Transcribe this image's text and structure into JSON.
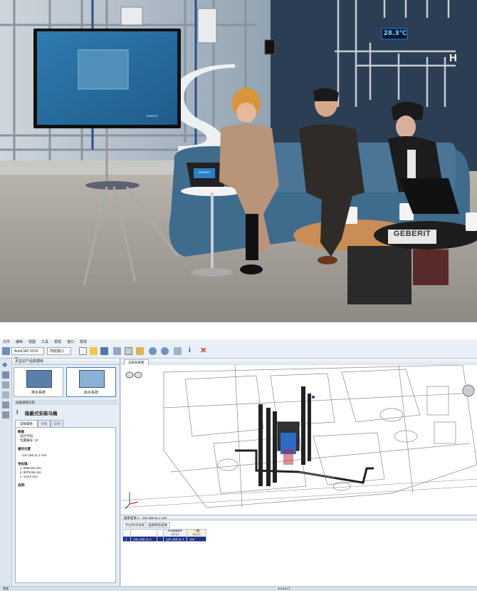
{
  "photo": {
    "temperature_display": "28.3℃",
    "wall_letter": "H",
    "brand_sign": "GEBERIT",
    "laptop_brand": "GEBERIT",
    "monitor_brand": "GEBERIT"
  },
  "app": {
    "menu": [
      "文件",
      "编辑",
      "视图",
      "工具",
      "帮助",
      "窗口",
      "帮助"
    ],
    "toolbar": {
      "dropdown1": "AutoCAD 2016 20",
      "dropdown2": "导航窗口"
    },
    "panel": {
      "title": "天宝达产品数据库",
      "tiles": [
        {
          "label": "排水系统"
        },
        {
          "label": "给水系统"
        }
      ],
      "section_title": "设备属性信息",
      "selected_item": "隐蔽式安装马桶",
      "tabs": [
        "常规属性",
        "参数",
        "说明"
      ],
      "props": {
        "data_header": "数据",
        "data_line1": "设计代码:",
        "data_line2": "位置编号: 10",
        "position_header": "编号位置",
        "position_value": "- 131.165.11.1 mm",
        "coords_header": "坐标值:",
        "x": "x: 5903.83 mm",
        "y": "y: 9879.56 mm",
        "z": "z: 144.8 mm",
        "notes_header": "说明:"
      }
    },
    "viewport": {
      "tab_label": "渲染效果图"
    },
    "results": {
      "title": "搜索结果 1 - 131.165.11.1 110",
      "subtabs": [
        "列出所有结果",
        "选择所有结果"
      ],
      "columns": [
        "",
        "",
        "",
        "NUMBER",
        "一般"
      ],
      "col_sub": [
        "",
        "",
        "",
        "Item2",
        "Item2"
      ],
      "row": {
        "index": "1",
        "id": "131.165.11.1",
        "number": "131.165.11.1",
        "value": "110"
      }
    },
    "status": {
      "left": "就绪",
      "right": "2019/4/27"
    }
  },
  "colors": {
    "toolbar_bg": "#e9eff6",
    "panel_bg": "#e6edf5",
    "selection": "#1f2f8c",
    "accent_red": "#d42a2a"
  }
}
